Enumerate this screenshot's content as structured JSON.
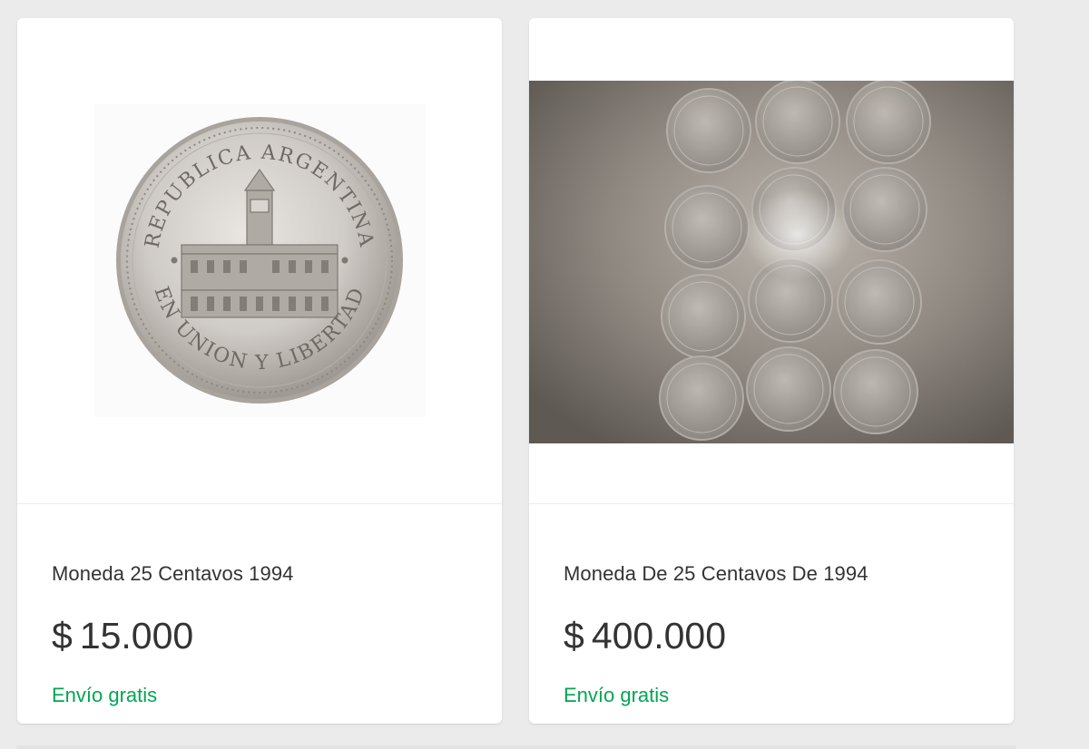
{
  "listings": [
    {
      "title": "Moneda 25 Centavos 1994",
      "price_symbol": "$",
      "price_amount": "15.000",
      "shipping": "Envío gratis",
      "image_alt": "Moneda 25 centavos República Argentina",
      "coin_top_text": "REPUBLICA ARGENTINA",
      "coin_bottom_text": "EN UNION Y LIBERTAD"
    },
    {
      "title": "Moneda De 25 Centavos De 1994",
      "price_symbol": "$",
      "price_amount": "400.000",
      "shipping": "Envío gratis",
      "image_alt": "Grupo de monedas de 25 centavos"
    }
  ],
  "colors": {
    "background": "#ebebeb",
    "card": "#ffffff",
    "text": "#333333",
    "shipping_green": "#00a650"
  }
}
